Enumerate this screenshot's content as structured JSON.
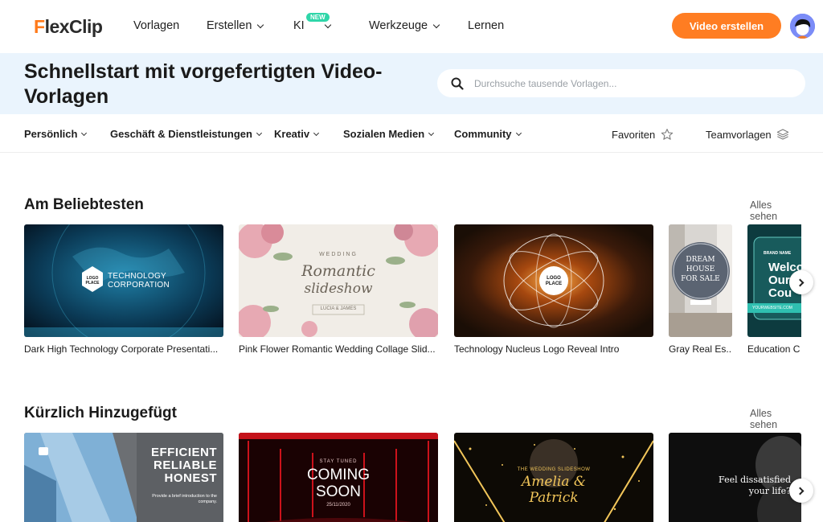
{
  "header": {
    "logo": {
      "first": "F",
      "rest": "lexClip"
    },
    "nav": [
      "Vorlagen",
      "Erstellen",
      "KI",
      "Werkzeuge",
      "Lernen"
    ],
    "badge": "NEW",
    "cta": "Video erstellen"
  },
  "hero": {
    "title": "Schnellstart mit vorgefertigten Video-Vorlagen",
    "search_placeholder": "Durchsuche tausende Vorlagen..."
  },
  "categories": [
    "Persönlich",
    "Geschäft & Dienstleistungen",
    "Kreativ",
    "Sozialen Medien",
    "Community"
  ],
  "extras": {
    "favorites": "Favoriten",
    "team": "Teamvorlagen"
  },
  "popular": {
    "title": "Am Beliebtesten",
    "see_all": "Alles sehen",
    "cards": [
      {
        "caption": "Dark High Technology Corporate Presentati...",
        "thumb": {
          "logo": "LOGO PLACE",
          "line1": "TECHNOLOGY",
          "line2": "CORPORATION"
        }
      },
      {
        "caption": "Pink Flower Romantic Wedding Collage Slid...",
        "thumb": {
          "kicker": "WEDDING",
          "line1": "Romantic",
          "line2": "slideshow",
          "names": "LUCIA & JAMES"
        }
      },
      {
        "caption": "Technology Nucleus Logo Reveal Intro",
        "thumb": {
          "logo": "LOGO PLACE"
        }
      },
      {
        "caption": "Gray Real Es...",
        "thumb": {
          "line1": "DREAM",
          "line2": "HOUSE",
          "line3": "FOR SALE"
        }
      },
      {
        "caption": "Education C",
        "thumb": {
          "brand": "BRAND NAME",
          "line1": "Welco",
          "line2": "Our",
          "line3": "Cou",
          "site": "YOURWEBSITE.COM"
        }
      }
    ]
  },
  "recent": {
    "title": "Kürzlich Hinzugefügt",
    "see_all": "Alles sehen",
    "cards": [
      {
        "thumb": {
          "line1": "EFFICIENT",
          "line2": "RELIABLE",
          "line3": "HONEST",
          "sub": "Provide a brief introduction to the company."
        }
      },
      {
        "thumb": {
          "kicker": "STAY TUNED",
          "line1": "COMING",
          "line2": "SOON",
          "date": "25/11/2020"
        }
      },
      {
        "thumb": {
          "kicker": "THE WEDDING SLIDESHOW",
          "line1": "Amelia &",
          "line2": "Patrick"
        }
      },
      {
        "thumb": {
          "line1": "Feel dissatisfied",
          "line2": "your life?"
        }
      }
    ]
  },
  "colors": {
    "accent": "#ff7d22",
    "hero_bg": "#eaf4fd",
    "badge": "#2fd6a9"
  }
}
